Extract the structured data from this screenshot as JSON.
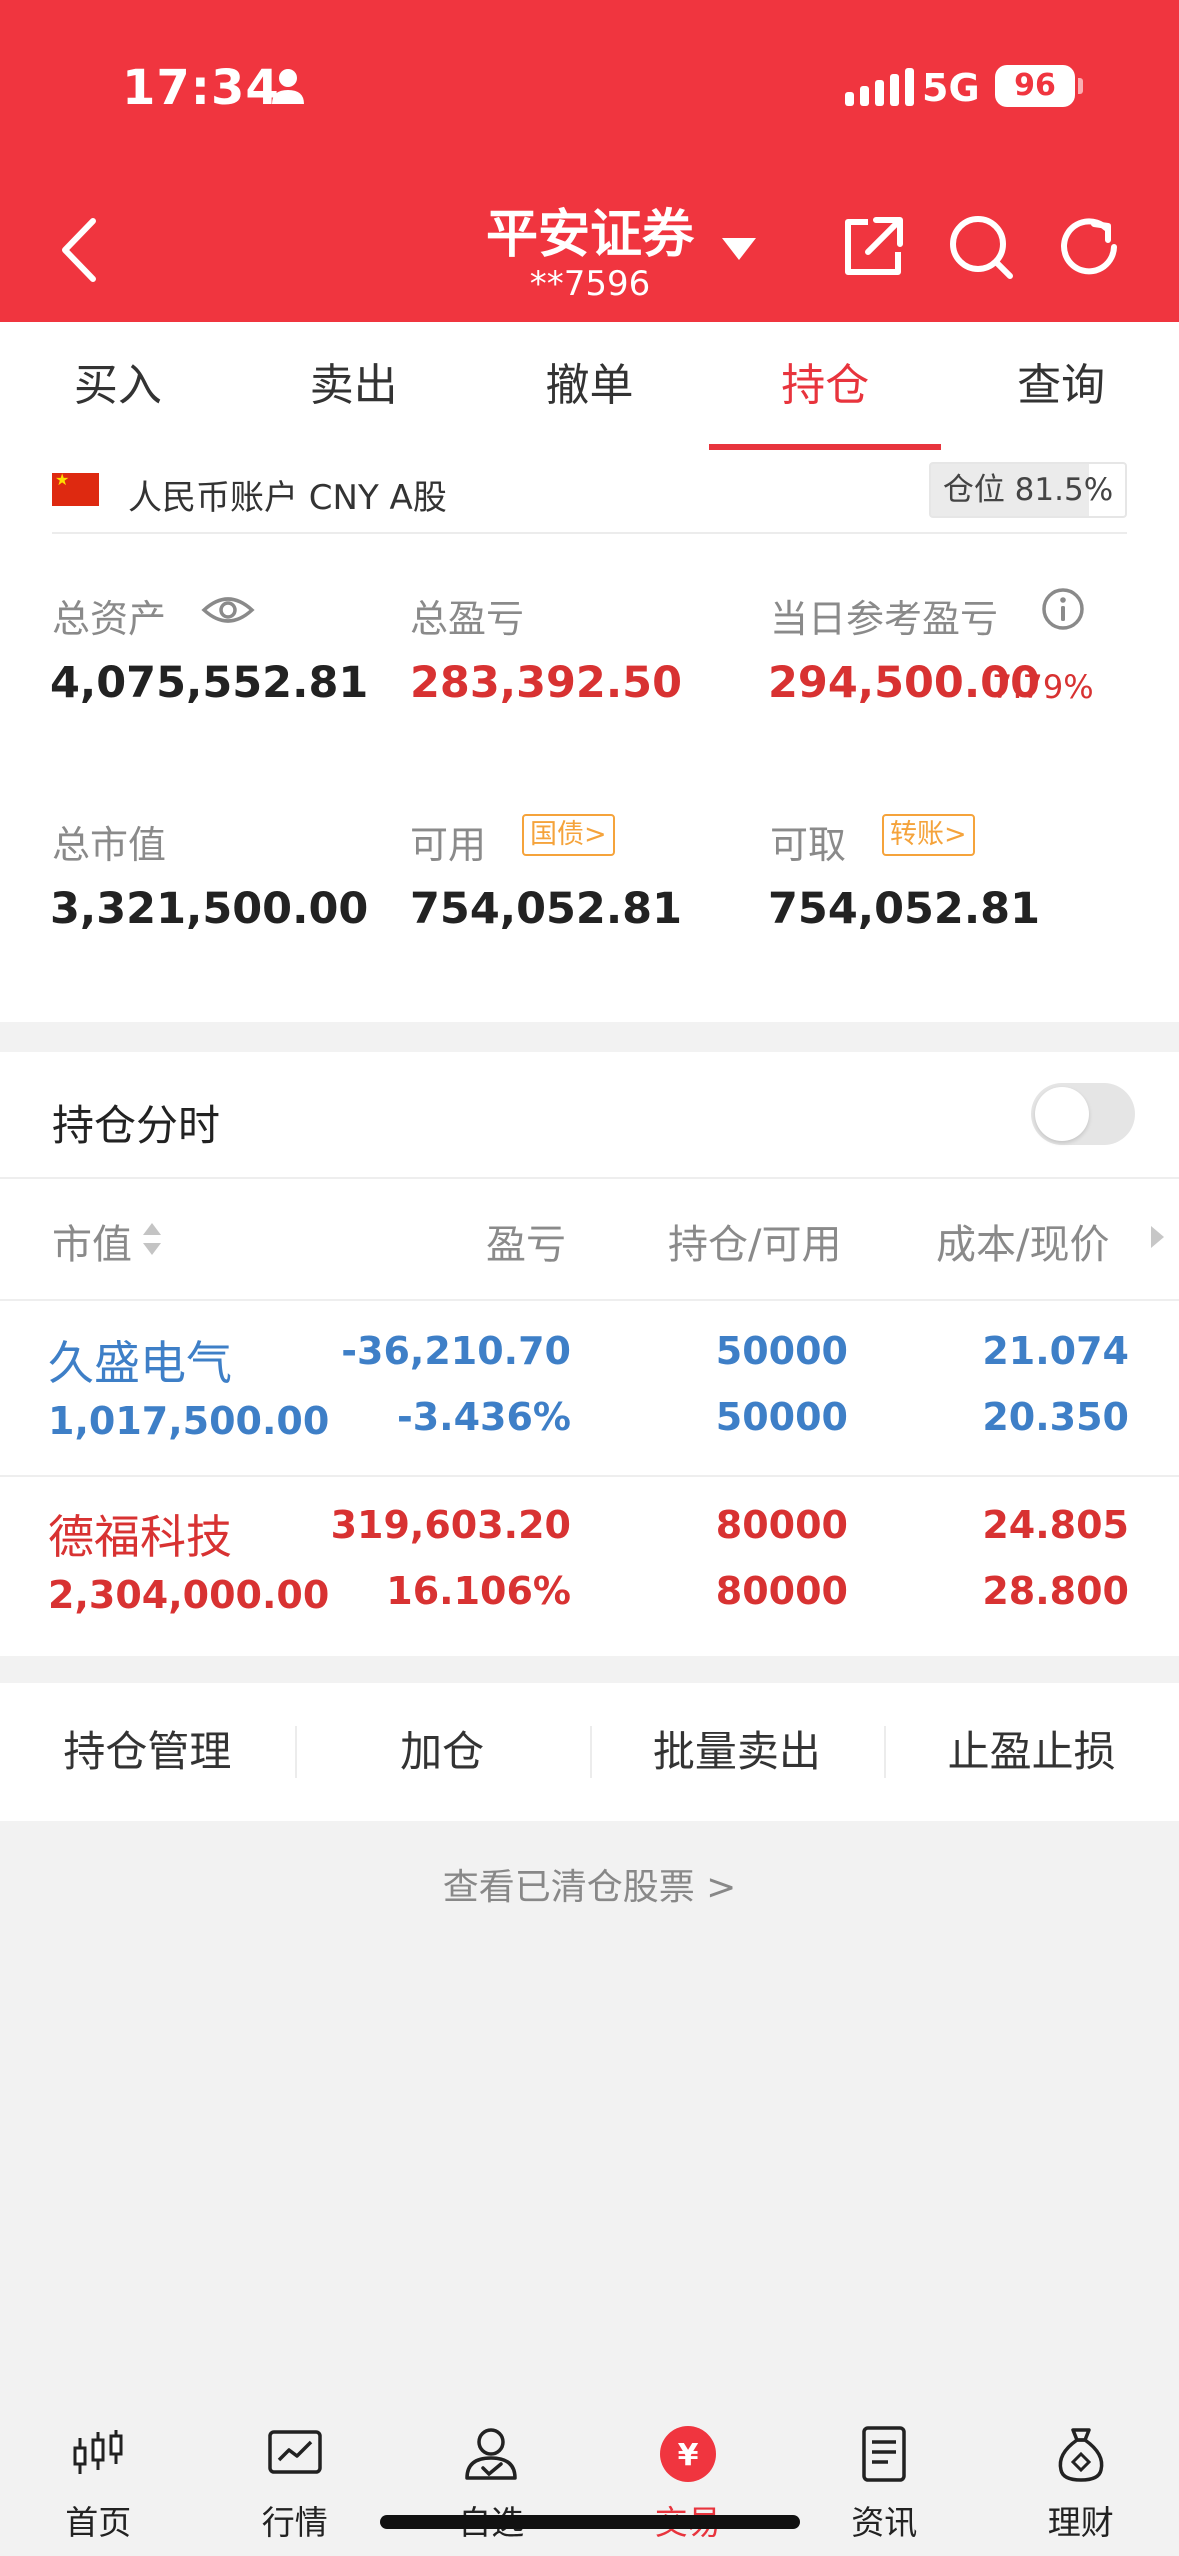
{
  "status_bar": {
    "time": "17:34",
    "network": "5G",
    "battery": "96"
  },
  "header": {
    "title": "平安证券",
    "account_no": "**7596"
  },
  "tabs": [
    {
      "label": "买入"
    },
    {
      "label": "卖出"
    },
    {
      "label": "撤单"
    },
    {
      "label": "持仓",
      "active": true
    },
    {
      "label": "查询"
    }
  ],
  "account": {
    "label": "人民币账户 CNY A股",
    "position_ratio": "仓位 81.5%",
    "position_fraction": 0.815
  },
  "stats": {
    "total_assets_label": "总资产",
    "total_assets": "4,075,552.81",
    "total_pnl_label": "总盈亏",
    "total_pnl": "283,392.50",
    "daily_pnl_label": "当日参考盈亏",
    "daily_pnl": "294,500.00",
    "daily_pnl_pct": "7.79%",
    "market_value_label": "总市值",
    "market_value": "3,321,500.00",
    "available_label": "可用",
    "available_tag": "国债>",
    "available": "754,052.81",
    "withdrawable_label": "可取",
    "withdrawable_tag": "转账>",
    "withdrawable": "754,052.81"
  },
  "holdings": {
    "title": "持仓分时",
    "columns": [
      "市值",
      "盈亏",
      "持仓/可用",
      "成本/现价"
    ],
    "rows": [
      {
        "name": "久盛电气",
        "market_value": "1,017,500.00",
        "pnl": "-36,210.70",
        "pnl_pct": "-3.436%",
        "position": "50000",
        "available": "50000",
        "cost": "21.074",
        "price": "20.350"
      },
      {
        "name": "德福科技",
        "market_value": "2,304,000.00",
        "pnl": "319,603.20",
        "pnl_pct": "16.106%",
        "position": "80000",
        "available": "80000",
        "cost": "24.805",
        "price": "28.800"
      }
    ]
  },
  "actions": [
    "持仓管理",
    "加仓",
    "批量卖出",
    "止盈止损"
  ],
  "cleared_link": "查看已清仓股票 >",
  "nav": [
    {
      "label": "首页",
      "icon": "candlestick-icon"
    },
    {
      "label": "行情",
      "icon": "market-chart-icon"
    },
    {
      "label": "自选",
      "icon": "watchlist-person-icon"
    },
    {
      "label": "交易",
      "icon": "trade-yuan-icon",
      "active": true
    },
    {
      "label": "资讯",
      "icon": "news-document-icon"
    },
    {
      "label": "理财",
      "icon": "money-bag-icon"
    }
  ],
  "colors": {
    "brand_red": "#f0353f",
    "loss_blue": "#3e7fc7",
    "gain_red": "#d83232",
    "tag_orange": "#f5a33b"
  }
}
